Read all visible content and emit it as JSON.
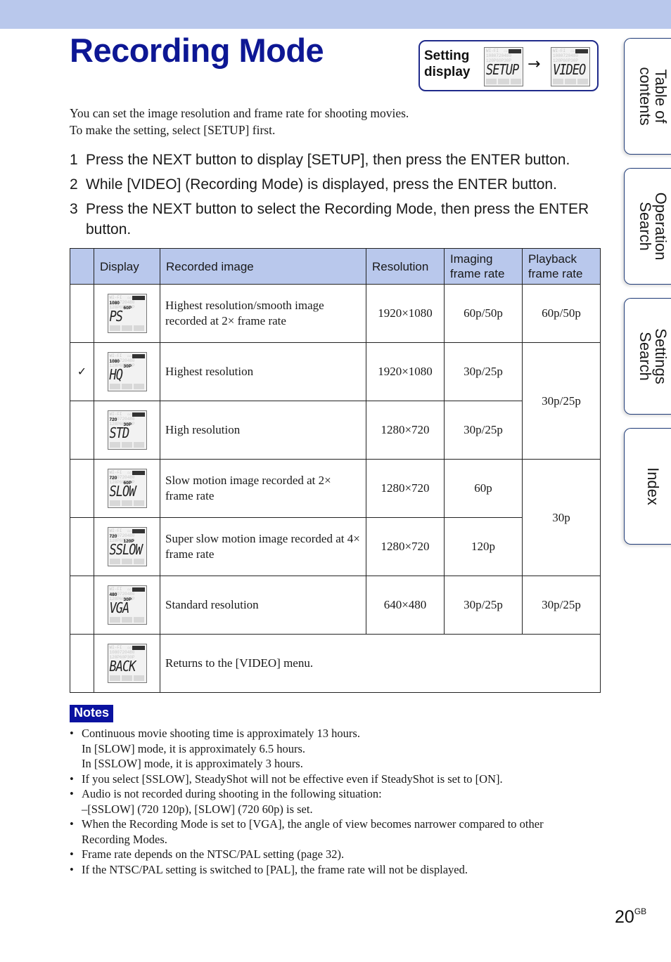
{
  "page_title": "Recording Mode",
  "setting_display": {
    "label_line1": "Setting",
    "label_line2": "display",
    "from_screen": "SETUP",
    "arrow": "→",
    "to_screen": "VIDEO"
  },
  "intro": {
    "line1": "You can set the image resolution and frame rate for shooting movies.",
    "line2": "To make the setting, select [SETUP] first."
  },
  "steps": [
    {
      "num": "1",
      "text": "Press the NEXT button to display [SETUP], then press the ENTER button."
    },
    {
      "num": "2",
      "text": "While [VIDEO] (Recording Mode) is displayed, press the ENTER button."
    },
    {
      "num": "3",
      "text": "Press the NEXT button to select the Recording Mode, then press the ENTER button."
    }
  ],
  "table": {
    "headers": {
      "check": "",
      "display": "Display",
      "recorded_image": "Recorded image",
      "resolution": "Resolution",
      "imaging_frame_rate": "Imaging frame rate",
      "playback_frame_rate": "Playback frame rate"
    },
    "rows": [
      {
        "checked": false,
        "display": "PS",
        "display_res": "1080",
        "display_rate": "60P",
        "recorded_image": "Highest resolution/smooth image recorded at 2× frame rate",
        "resolution": "1920×1080",
        "imaging_frame_rate": "60p/50p",
        "playback_frame_rate": "60p/50p"
      },
      {
        "checked": true,
        "display": "HQ",
        "display_res": "1080",
        "display_rate": "30P",
        "recorded_image": "Highest resolution",
        "resolution": "1920×1080",
        "imaging_frame_rate": "30p/25p",
        "playback_frame_rate": "30p/25p"
      },
      {
        "checked": false,
        "display": "STD",
        "display_res": "720",
        "display_rate": "30P",
        "recorded_image": "High resolution",
        "resolution": "1280×720",
        "imaging_frame_rate": "30p/25p",
        "playback_frame_rate": "30p/25p"
      },
      {
        "checked": false,
        "display": "SLOW",
        "display_res": "720",
        "display_rate": "60P",
        "recorded_image": "Slow motion image recorded at 2× frame rate",
        "resolution": "1280×720",
        "imaging_frame_rate": "60p",
        "playback_frame_rate": "30p"
      },
      {
        "checked": false,
        "display": "SSLOW",
        "display_res": "720",
        "display_rate": "120P",
        "recorded_image": "Super slow motion image recorded at 4× frame rate",
        "resolution": "1280×720",
        "imaging_frame_rate": "120p",
        "playback_frame_rate": "30p"
      },
      {
        "checked": false,
        "display": "VGA",
        "display_res": "480",
        "display_rate": "30P",
        "recorded_image": "Standard resolution",
        "resolution": "640×480",
        "imaging_frame_rate": "30p/25p",
        "playback_frame_rate": "30p/25p"
      },
      {
        "checked": false,
        "display": "BACK",
        "display_res": "",
        "display_rate": "",
        "recorded_image": "Returns to the [VIDEO] menu.",
        "resolution": "",
        "imaging_frame_rate": "",
        "playback_frame_rate": ""
      }
    ],
    "check_icon": "✓"
  },
  "notes": {
    "badge": "Notes",
    "items": [
      {
        "type": "bullet",
        "text": "Continuous movie shooting time is approximately 13 hours."
      },
      {
        "type": "cont",
        "text": "In [SLOW] mode, it is approximately 6.5 hours."
      },
      {
        "type": "cont",
        "text": "In [SSLOW] mode, it is approximately 3 hours."
      },
      {
        "type": "bullet",
        "text": "If you select [SSLOW], SteadyShot will not be effective even if SteadyShot is set to [ON]."
      },
      {
        "type": "bullet",
        "text": "Audio is not recorded during shooting in the following situation:"
      },
      {
        "type": "dash",
        "text": "[SSLOW] (720 120p), [SLOW] (720 60p) is set."
      },
      {
        "type": "bullet",
        "text": "When the Recording Mode is set to [VGA], the angle of view becomes narrower compared to other"
      },
      {
        "type": "cont",
        "text": "Recording Modes."
      },
      {
        "type": "bullet",
        "text": "Frame rate depends on the NTSC/PAL setting (page 32)."
      },
      {
        "type": "bullet",
        "text": "If the NTSC/PAL setting is switched to [PAL], the frame rate will not be displayed."
      }
    ]
  },
  "side_tabs": [
    {
      "label": "Table of\ncontents"
    },
    {
      "label": "Operation\nSearch"
    },
    {
      "label": "Settings\nSearch"
    },
    {
      "label": "Index"
    }
  ],
  "page_number": {
    "num": "20",
    "suffix": "GB"
  }
}
